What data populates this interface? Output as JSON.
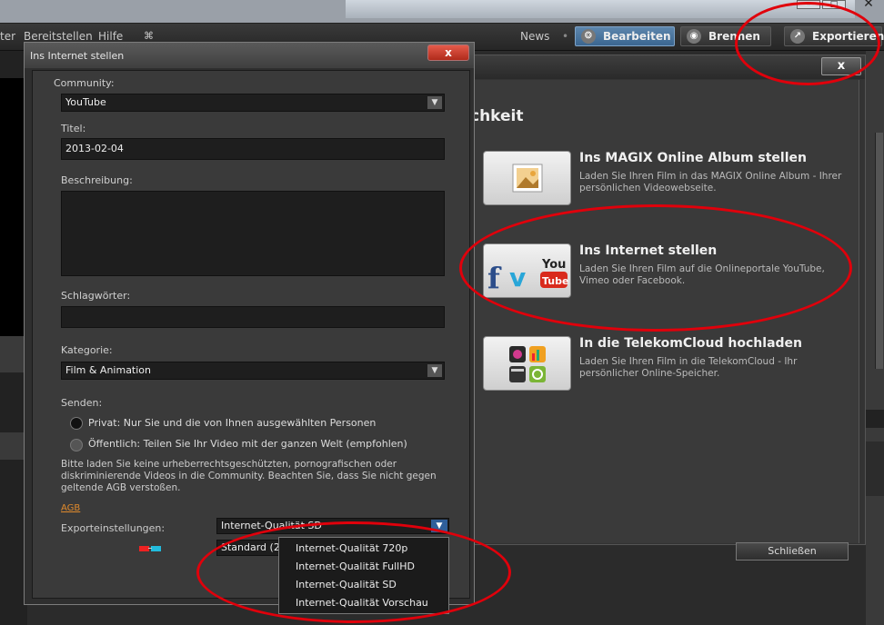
{
  "menu": {
    "item_1": "ter",
    "item_2": "Bereitstellen",
    "item_3": "Hilfe",
    "news": "News"
  },
  "toolbar": {
    "bearbeiten": "Bearbeiten",
    "brennen": "Brennen",
    "exportieren": "Exportieren"
  },
  "export_dialog": {
    "heading": "chkeit",
    "close_label": "x",
    "options": [
      {
        "title": "Ins MAGIX Online Album stellen",
        "desc": "Laden Sie Ihren Film in das MAGIX Online Album - Ihrer persönlichen Videowebseite."
      },
      {
        "title": "Ins Internet stellen",
        "desc": "Laden Sie Ihren Film auf die Onlineportale YouTube, Vimeo oder Facebook."
      },
      {
        "title": "In die TelekomCloud hochladen",
        "desc": "Laden Sie Ihren Film in die TelekomCloud - Ihr persönlicher Online-Speicher."
      }
    ],
    "youtube_tile": "You",
    "youtube_tile_2": "Tube",
    "close_button": "Schließen"
  },
  "dialog": {
    "title": "Ins Internet stellen",
    "close_label": "x",
    "community_label": "Community:",
    "community_value": "YouTube",
    "titel_label": "Titel:",
    "titel_value": "2013-02-04",
    "beschreibung_label": "Beschreibung:",
    "schlagwoerter_label": "Schlagwörter:",
    "kategorie_label": "Kategorie:",
    "kategorie_value": "Film & Animation",
    "senden_label": "Senden:",
    "privat": "Privat: Nur Sie und die von Ihnen ausgewählten Personen",
    "oeffentlich": "Öffentlich: Teilen Sie Ihr Video mit der ganzen Welt (empfohlen)",
    "warning": "Bitte laden Sie keine urheberrechtsgeschützten, pornografischen oder diskriminierende Videos in die Community. Beachten Sie, dass Sie nicht gegen geltende AGB verstoßen.",
    "agb": "AGB",
    "export_label": "Exporteinstellungen:",
    "export_value": "Internet-Qualität SD",
    "standard_value": "Standard (20"
  },
  "dropdown": [
    "Internet-Qualität 720p",
    "Internet-Qualität FullHD",
    "Internet-Qualität SD",
    "Internet-Qualität Vorschau"
  ],
  "colors": {
    "highlight_ring": "#e0000b",
    "bearbeiten_active": "#3b6690",
    "agb_link": "#e08a2c"
  }
}
